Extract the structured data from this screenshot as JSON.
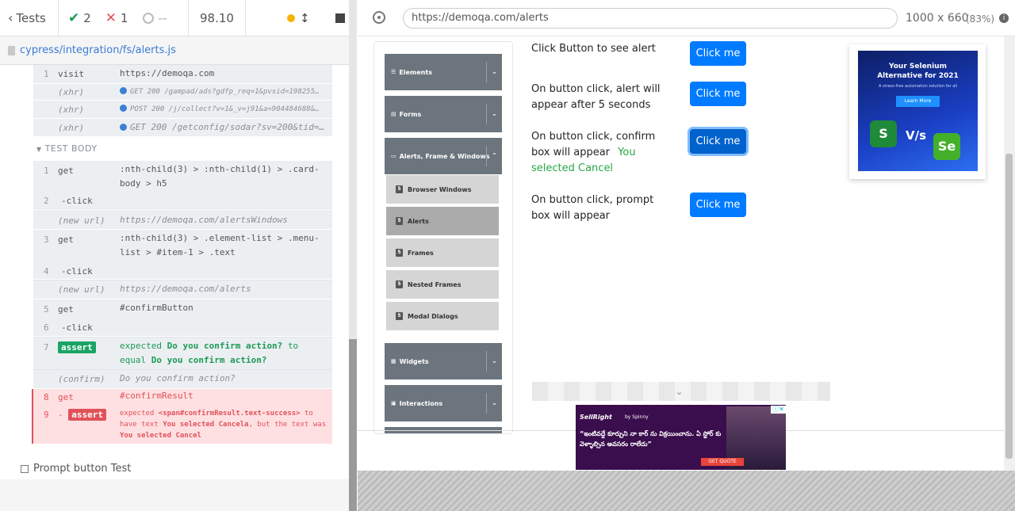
{
  "reporter": {
    "back_label": "Tests",
    "passed": "2",
    "failed": "1",
    "pending": "--",
    "duration": "98.10"
  },
  "spec": {
    "path": "cypress/integration/fs/alerts.js"
  },
  "commands_before": [
    {
      "n": "1",
      "name": "visit",
      "msg": "https://demoqa.com"
    },
    {
      "n": "",
      "name": "(xhr)",
      "msg": "GET 200 /gampad/ads?gdfp_req=1&pvsid=198255…"
    },
    {
      "n": "",
      "name": "(xhr)",
      "msg": "POST 200 /j/collect?v=1&_v=j91&a=904484688&…"
    },
    {
      "n": "",
      "name": "(xhr)",
      "msg": "GET 200 /getconfig/sodar?sv=200&tid=…"
    }
  ],
  "test_body_label": "TEST BODY",
  "commands": [
    {
      "n": "1",
      "name": "get",
      "msg": ":nth-child(3) > :nth-child(1) > .card-body > h5"
    },
    {
      "n": "2",
      "name": "-click",
      "msg": ""
    },
    {
      "n": "",
      "name": "(new url)",
      "msg": "https://demoqa.com/alertsWindows"
    },
    {
      "n": "3",
      "name": "get",
      "msg": ":nth-child(3) > .element-list > .menu-list > #item-1 > .text"
    },
    {
      "n": "4",
      "name": "-click",
      "msg": ""
    },
    {
      "n": "",
      "name": "(new url)",
      "msg": "https://demoqa.com/alerts"
    },
    {
      "n": "5",
      "name": "get",
      "msg": "#confirmButton"
    },
    {
      "n": "6",
      "name": "-click",
      "msg": ""
    },
    {
      "n": "7",
      "name": "assert",
      "msg_parts": [
        "expected",
        "Do you confirm action?",
        "to equal",
        "Do you confirm action?"
      ]
    },
    {
      "n": "",
      "name": "(confirm)",
      "msg": "Do you confirm action?"
    },
    {
      "n": "8",
      "name": "get",
      "msg": "#confirmResult"
    },
    {
      "n": "9",
      "name": "assert",
      "msg_parts": [
        "expected",
        "<span#confirmResult.text-success>",
        "to have text",
        "You selected Cancela",
        ", but the text was",
        "You selected Cancel"
      ]
    }
  ],
  "next_test": "Prompt button Test",
  "aut": {
    "url": "https://demoqa.com/alerts",
    "viewport": "1000 x 660",
    "scale": "(83%)"
  },
  "menu": {
    "groups": [
      "Elements",
      "Forms",
      "Alerts, Frame & Windows",
      "Widgets",
      "Interactions"
    ],
    "subitems": [
      "Browser Windows",
      "Alerts",
      "Frames",
      "Nested Frames",
      "Modal Dialogs"
    ]
  },
  "alerts_page": {
    "rows": [
      {
        "text": "Click Button to see alert",
        "button": "Click me"
      },
      {
        "text": "On button click, alert will appear after 5 seconds",
        "button": "Click me"
      },
      {
        "text": "On button click, confirm box will appear",
        "result": "You selected Cancel",
        "button": "Click me"
      },
      {
        "text": "On button click, prompt box will appear",
        "button": "Click me"
      }
    ]
  },
  "ads": {
    "selenium": {
      "title": "Your Selenium Alternative for 2021",
      "sub": "A stress-free automation solution for all",
      "cta": "Learn More",
      "vs": "V/s",
      "se": "Se",
      "s": "S"
    },
    "telugu": {
      "brand": "SellRight",
      "by": "by Spinny",
      "text": "“ఇంటివద్దే కూర్చుని నా కార్ ను విక్రయించాను. ఏ స్టోర్ కు వెళ్ళాల్సిన అవసరం రాలేదు”",
      "cta": "GET QUOTE"
    }
  },
  "colors": {
    "accent_blue": "#007bff",
    "pass_green": "#1a9a54",
    "fail_red": "#e0525a",
    "fail_bg": "#ffe0e2"
  }
}
